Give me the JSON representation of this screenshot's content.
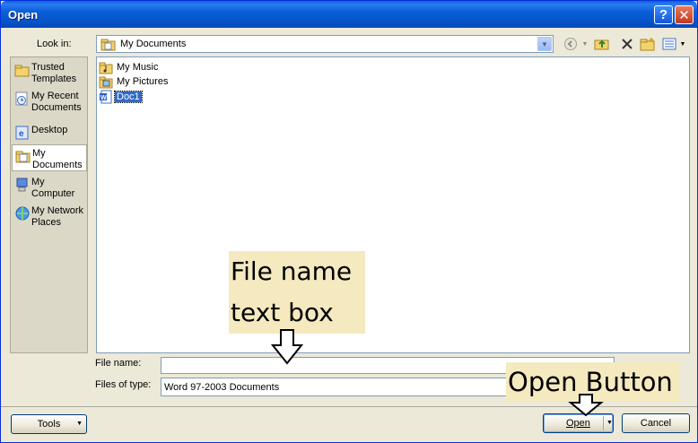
{
  "window": {
    "title": "Open",
    "help": "?",
    "close": "✕"
  },
  "toolbar": {
    "lookin_label": "Look in:",
    "lookin_value": "My Documents",
    "icons": [
      "back-icon",
      "up-folder-icon",
      "delete-icon",
      "new-folder-icon",
      "views-icon"
    ]
  },
  "places": [
    {
      "label": "Trusted Templates",
      "icon": "folder-icon"
    },
    {
      "label": "My Recent Documents",
      "icon": "recent-documents-icon"
    },
    {
      "label": "Desktop",
      "icon": "desktop-icon"
    },
    {
      "label": "My Documents",
      "icon": "my-documents-icon",
      "selected": true
    },
    {
      "label": "My Computer",
      "icon": "my-computer-icon"
    },
    {
      "label": "My Network Places",
      "icon": "network-places-icon"
    }
  ],
  "files": [
    {
      "name": "My Music",
      "icon": "music-folder-icon"
    },
    {
      "name": "My Pictures",
      "icon": "pictures-folder-icon"
    },
    {
      "name": "Doc1",
      "icon": "word-document-icon",
      "selected": true
    }
  ],
  "form": {
    "file_name_label": "File name:",
    "file_name_value": "",
    "file_type_label": "Files of type:",
    "file_type_value": "Word 97-2003 Documents"
  },
  "buttons": {
    "tools": "Tools",
    "open": "Open",
    "cancel": "Cancel"
  },
  "annotations": {
    "file_name_line1": "File name",
    "file_name_line2": "text box",
    "open_button": "Open Button"
  },
  "colors": {
    "titlebar": "#0a5fd8",
    "selection": "#316ac5",
    "annotation_bg": "#f5e9c0",
    "dialog_bg": "#ece9d8"
  }
}
